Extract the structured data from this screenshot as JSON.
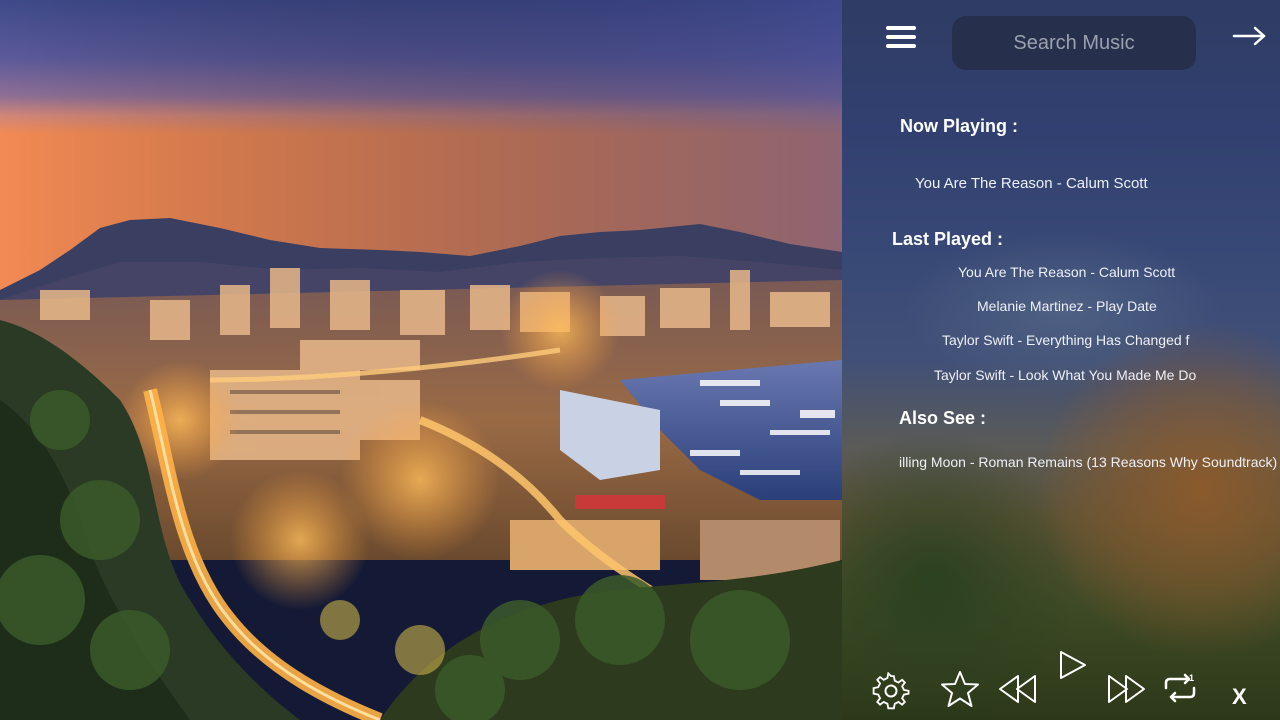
{
  "header": {
    "search_placeholder": "Search Music"
  },
  "now_playing": {
    "heading": "Now Playing :",
    "track": "You Are The Reason - Calum Scott"
  },
  "last_played": {
    "heading": "Last Played :",
    "tracks": [
      "You Are The Reason - Calum Scott",
      "Melanie Martinez - Play Date",
      "Taylor Swift - Everything Has Changed f",
      "Taylor Swift - Look What You Made Me Do"
    ]
  },
  "also_see": {
    "heading": "Also See :",
    "track": "illing Moon - Roman Remains (13 Reasons Why Soundtrack)"
  },
  "controls": {
    "close_label": "X",
    "icons": [
      "gear-icon",
      "star-icon",
      "rewind-icon",
      "play-icon",
      "fast-forward-icon",
      "repeat-one-icon"
    ]
  },
  "colors": {
    "panel_text": "#ffffff",
    "search_bg": "#26304d"
  }
}
